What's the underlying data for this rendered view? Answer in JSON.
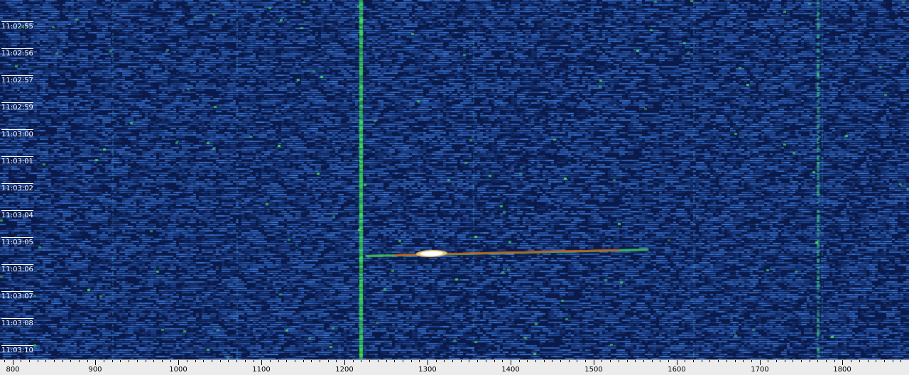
{
  "waterfall": {
    "time_labels": [
      "11:02:55",
      "11:02:56",
      "11:02:57",
      "11:02:59",
      "11:03:00",
      "11:03:01",
      "11:03:02",
      "11:03:04",
      "11:03:05",
      "11:03:06",
      "11:03:07",
      "11:03:08",
      "11:03:10"
    ],
    "freq_labels": [
      "800",
      "900",
      "1000",
      "1100",
      "1200",
      "1300",
      "1400",
      "1500",
      "1600",
      "1700",
      "1800"
    ],
    "freq_range": [
      785,
      1880
    ],
    "colors": {
      "background": "#0a1a4a",
      "noise": "#2a5ad8",
      "carrier": "#3cc850",
      "signal_hot": "#ffffff",
      "signal_warm": "#d05a20"
    }
  }
}
